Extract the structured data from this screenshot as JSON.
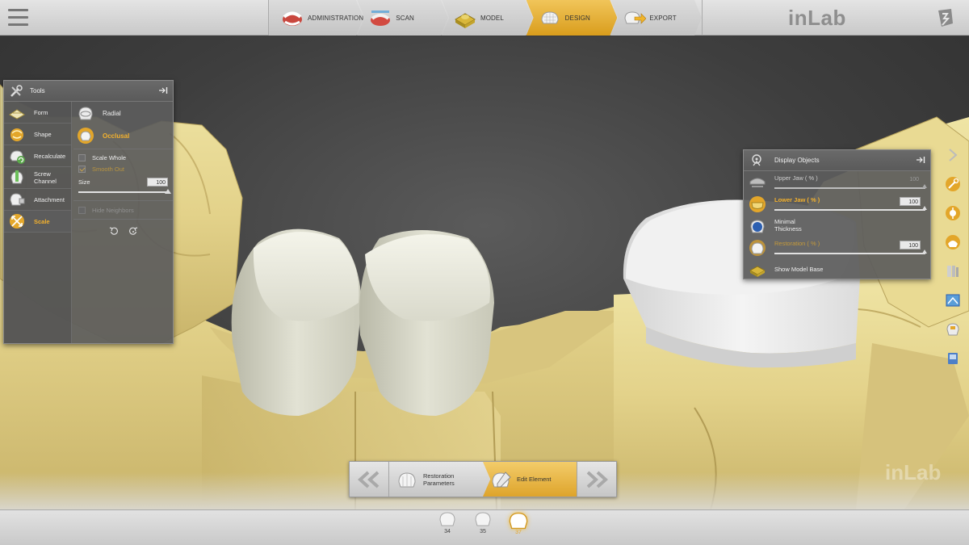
{
  "app": {
    "brand": "inLab",
    "watermark": "inLab"
  },
  "phases": [
    {
      "id": "administration",
      "label": "ADMINISTRATION",
      "active": false
    },
    {
      "id": "scan",
      "label": "SCAN",
      "active": false
    },
    {
      "id": "model",
      "label": "MODEL",
      "active": false
    },
    {
      "id": "design",
      "label": "DESIGN",
      "active": true
    },
    {
      "id": "export",
      "label": "EXPORT",
      "active": false
    }
  ],
  "tools_panel": {
    "title": "Tools",
    "tools": [
      {
        "label": "Form",
        "active": false
      },
      {
        "label": "Shape",
        "active": false
      },
      {
        "label": "Recalculate",
        "active": false
      },
      {
        "label": "Screw\nChannel",
        "active": false
      },
      {
        "label": "Attachment",
        "active": false
      },
      {
        "label": "Scale",
        "active": true
      }
    ],
    "modes": [
      {
        "label": "Radial",
        "active": false
      },
      {
        "label": "Occlusal",
        "active": true
      }
    ],
    "scale_whole": {
      "label": "Scale Whole",
      "checked": false
    },
    "smooth_out": {
      "label": "Smooth Out",
      "checked": true
    },
    "size": {
      "label": "Size",
      "value": "100",
      "level_percent": 100
    },
    "hide_neighbors": {
      "label": "Hide Neighbors",
      "checked": false
    }
  },
  "display_panel": {
    "title": "Display Objects",
    "items": [
      {
        "label": "Upper Jaw  ( % )",
        "value": "100",
        "level_percent": 100
      },
      {
        "label": "Lower Jaw  ( % )",
        "value": "100",
        "level_percent": 100
      },
      {
        "label": "Minimal\nThickness"
      },
      {
        "label": "Restoration ( % )",
        "value": "100",
        "level_percent": 100
      },
      {
        "label": "Show Model Base"
      }
    ]
  },
  "steps": [
    {
      "label": "Restoration\nParameters",
      "active": false
    },
    {
      "label": "Edit Element",
      "active": true
    }
  ],
  "teeth": [
    {
      "number": "34",
      "active": false
    },
    {
      "number": "35",
      "active": false
    },
    {
      "number": "37",
      "active": true
    }
  ],
  "colors": {
    "accent": "#f3b12e",
    "model": "#e8d98f",
    "restoration": "#e4e4de"
  }
}
